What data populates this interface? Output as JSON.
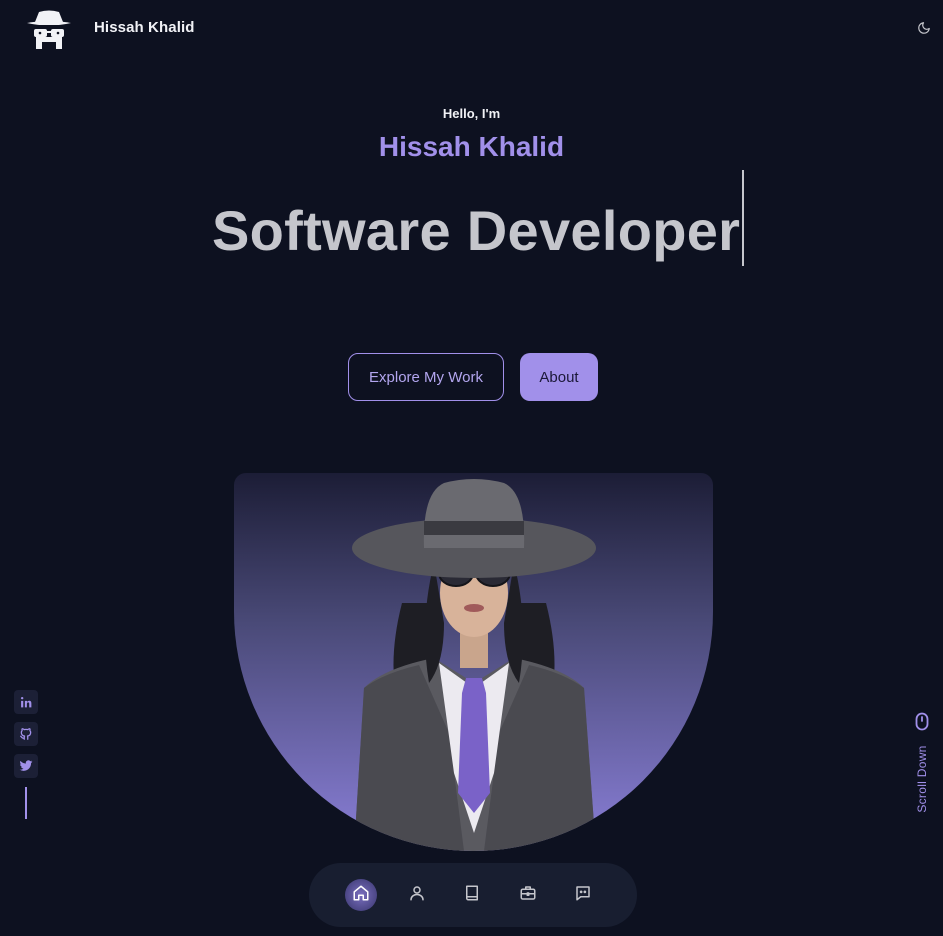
{
  "header": {
    "brand": "Hissah Khalid",
    "logo_icon": "spy-hat-glasses-logo",
    "theme_icon": "moon-icon"
  },
  "hero": {
    "greeting": "Hello, I'm",
    "name": "Hissah Khalid",
    "role": "Software Developer"
  },
  "buttons": {
    "explore": "Explore My Work",
    "about": "About"
  },
  "social": [
    {
      "name": "linkedin",
      "icon": "linkedin-icon"
    },
    {
      "name": "github",
      "icon": "github-icon"
    },
    {
      "name": "twitter",
      "icon": "twitter-icon"
    }
  ],
  "scroll": {
    "label": "Scroll Down",
    "icon": "mouse-icon"
  },
  "nav": [
    {
      "icon": "home-icon",
      "active": true
    },
    {
      "icon": "user-icon",
      "active": false
    },
    {
      "icon": "book-icon",
      "active": false
    },
    {
      "icon": "briefcase-icon",
      "active": false
    },
    {
      "icon": "message-icon",
      "active": false
    }
  ],
  "colors": {
    "background": "#0d1120",
    "accent": "#a190ea",
    "text": "#f1f2f6",
    "role_text": "#c5c6cc",
    "nav_bg": "#181e30"
  }
}
